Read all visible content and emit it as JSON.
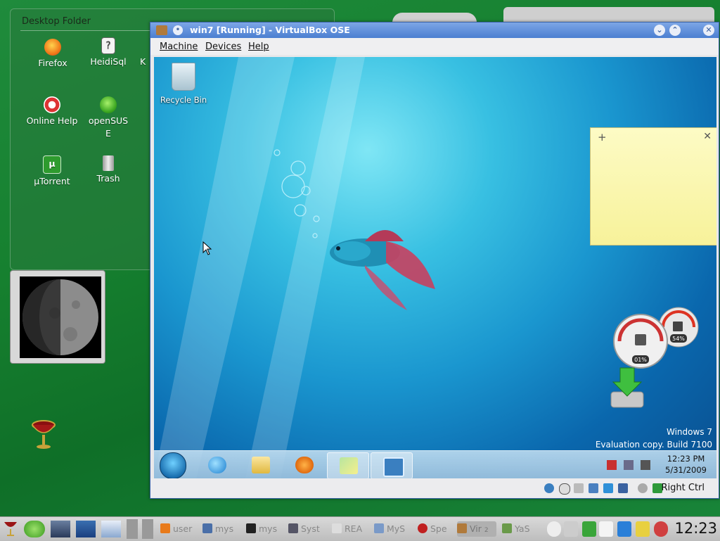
{
  "desktop": {
    "folder_title": "Desktop Folder",
    "icons": [
      {
        "label": "Firefox",
        "icon": "firefox-icon"
      },
      {
        "label": "HeidiSql",
        "icon": "heidisql-icon"
      },
      {
        "label": "Online Help",
        "icon": "help-lifebuoy-icon"
      },
      {
        "label": "openSUS E",
        "icon": "opensuse-icon"
      },
      {
        "label": "µTorrent",
        "icon": "utorrent-icon"
      },
      {
        "label": "Trash",
        "icon": "trash-icon"
      }
    ],
    "partial_icon_label": "K"
  },
  "vbox": {
    "title": "win7 [Running] - VirtualBox OSE",
    "menu": [
      "Machine",
      "Devices",
      "Help"
    ],
    "host_key": "Right Ctrl"
  },
  "guest": {
    "recycle_bin": "Recycle Bin",
    "sticky_add": "+",
    "sticky_close": "✕",
    "watermark_line1": "Windows 7",
    "watermark_line2": "Evaluation copy. Build 7100",
    "cpu_percent": "01%",
    "mem_percent": "54%",
    "clock_time": "12:23 PM",
    "clock_date": "5/31/2009"
  },
  "host_panel": {
    "tasks": [
      {
        "label": "user"
      },
      {
        "label": "mys"
      },
      {
        "label": "mys"
      },
      {
        "label": "Syst"
      },
      {
        "label": "REA"
      },
      {
        "label": "MyS"
      },
      {
        "label": "Spe"
      },
      {
        "label": "Vir"
      },
      {
        "label": "YaS"
      }
    ],
    "task_group_count": "2",
    "clock": "12:23"
  },
  "colors": {
    "desktop_green": "#16802f",
    "titlebar_blue": "#4b7fd1",
    "sticky_yellow": "#f7f29a"
  }
}
